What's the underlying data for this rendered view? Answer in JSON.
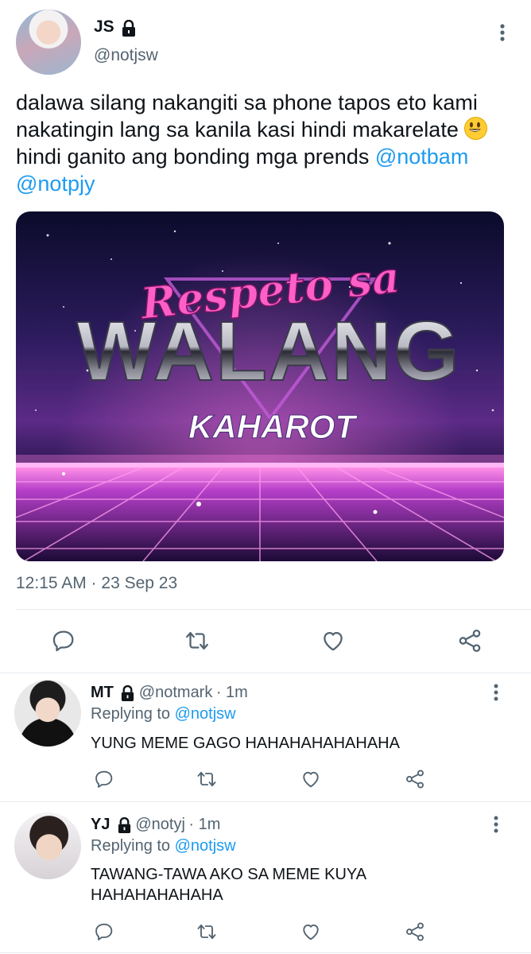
{
  "tweet": {
    "author_name": "JS",
    "author_handle": "@notjsw",
    "text_parts": [
      "dalawa silang nakangiti sa phone tapos eto kami nakatingin lang sa kanila kasi hindi makarelate ",
      " hindi ganito ang bonding mga prends ",
      "@notbam",
      " ",
      "@notpjy"
    ],
    "media": {
      "line1": "Respeto sa",
      "line2": "WALANG",
      "line3": "KAHAROT"
    },
    "timestamp": "12:15 AM · 23 Sep 23"
  },
  "replies": [
    {
      "name": "MT",
      "handle": "@notmark",
      "time": "· 1m",
      "replying_prefix": "Replying to",
      "replying_to": "@notjsw",
      "text": "YUNG MEME GAGO HAHAHAHAHAHAHA"
    },
    {
      "name": "YJ",
      "handle": "@notyj",
      "time": "· 1m",
      "replying_prefix": "Replying to",
      "replying_to": "@notjsw",
      "text": "TAWANG-TAWA AKO SA MEME KUYA HAHAHAHAHAHA"
    }
  ],
  "icons": {
    "reply": "reply-icon",
    "retweet": "retweet-icon",
    "like": "like-icon",
    "share": "share-icon",
    "more": "more-icon",
    "lock": "lock-icon"
  },
  "colors": {
    "mention": "#1d9bf0",
    "secondary_text": "#536471",
    "divider": "#e6ecf0"
  }
}
